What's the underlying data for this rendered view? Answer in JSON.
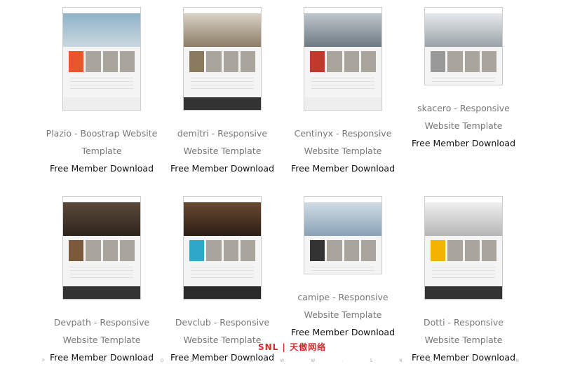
{
  "cards": [
    {
      "title": "Plazio - Boostrap Website Template",
      "download": "Free Member Download",
      "hero": "linear-gradient(#8fb3c9,#c9d7de)",
      "accent": "#e8562a",
      "footer": "#eeeeee"
    },
    {
      "title": "demitri - Responsive Website Template",
      "download": "Free Member Download",
      "hero": "linear-gradient(#d9d2c6,#8b7c66)",
      "accent": "#8a7a5e",
      "footer": "#333333"
    },
    {
      "title": "Centinyx - Responsive Website Template",
      "download": "Free Member Download",
      "hero": "linear-gradient(#bfc6cc,#6e7a83)",
      "accent": "#c0392b",
      "footer": "#eeeeee"
    },
    {
      "title": "skacero - Responsive Website Template",
      "download": "Free Member Download",
      "hero": "linear-gradient(#e6e9ec,#9aa3a8)",
      "accent": "#999999",
      "footer": "#eeeeee",
      "short": true
    },
    {
      "title": "Devpath - Responsive Website Template",
      "download": "Free Member Download",
      "hero": "linear-gradient(#5b4a3a,#2e241b)",
      "accent": "#7a5a3a",
      "footer": "#333333"
    },
    {
      "title": "Devclub - Responsive Website Template",
      "download": "Free Member Download",
      "hero": "linear-gradient(#6a4a30,#2a1e14)",
      "accent": "#2ea7c9",
      "footer": "#2a2a2a"
    },
    {
      "title": "camipe - Responsive Website Template",
      "download": "Free Member Download",
      "hero": "linear-gradient(#d0dce6,#8aa2b5)",
      "accent": "#333333",
      "footer": "#eeeeee",
      "short": true
    },
    {
      "title": "Dotti - Responsive Website Template",
      "download": "Free Member Download",
      "hero": "linear-gradient(#f0f0f0,#b5b5b5)",
      "accent": "#f2b400",
      "footer": "#333333"
    }
  ],
  "logo": "SNL | 天傲网络",
  "watermark": "PHOTO BY WWW.SNL.CN"
}
